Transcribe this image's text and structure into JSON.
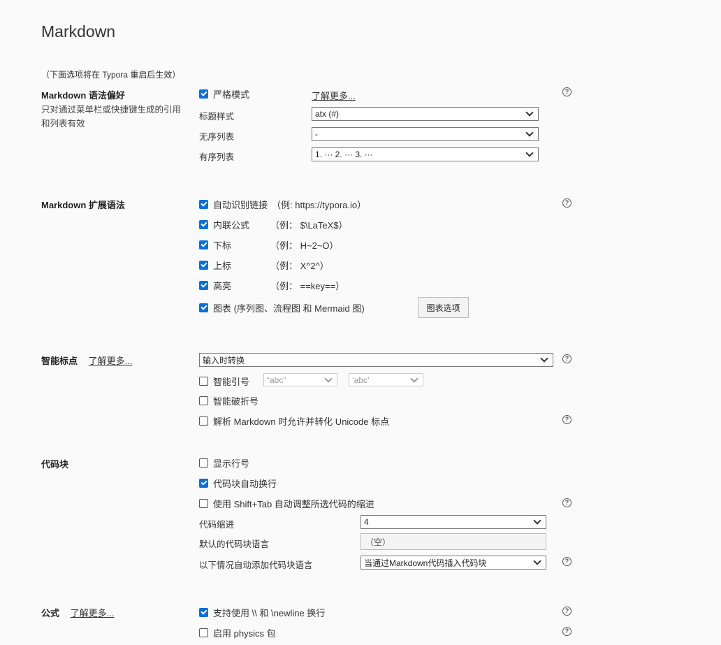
{
  "page_title": "Markdown",
  "restart_note": "（下面选项将在 Typora 重启后生效）",
  "syntax": {
    "title": "Markdown 语法偏好",
    "desc": "只对通过菜单栏或快捷键生成的引用和列表有效",
    "strict_mode_label": "严格模式",
    "strict_mode_checked": true,
    "learn_more": "了解更多...",
    "heading_style_label": "标题样式",
    "heading_style_value": "atx (#)",
    "unordered_label": "无序列表",
    "unordered_value": "-",
    "ordered_label": "有序列表",
    "ordered_value": "1. ··· 2. ··· 3. ···"
  },
  "extended": {
    "title": "Markdown 扩展语法",
    "items": [
      {
        "label": "自动识别链接",
        "example": "（例: https://typora.io）",
        "checked": true
      },
      {
        "label": "内联公式",
        "example": "（例：  $\\LaTeX$）",
        "checked": true
      },
      {
        "label": "下标",
        "example": "（例：  H~2~O）",
        "checked": true
      },
      {
        "label": "上标",
        "example": "（例：  X^2^）",
        "checked": true
      },
      {
        "label": "高亮",
        "example": "（例：  ==key==）",
        "checked": true
      },
      {
        "label": "图表 (序列图、流程图 和 Mermaid 图)",
        "example": "",
        "checked": true
      }
    ],
    "chart_options_button": "图表选项"
  },
  "smart_punct": {
    "title": "智能标点",
    "learn_more": "了解更多...",
    "mode_value": "输入时转换",
    "smart_quotes_label": "智能引号",
    "smart_quotes_checked": false,
    "double_quote_value": "“abc”",
    "single_quote_value": "‘abc’",
    "smart_dash_label": "智能破折号",
    "smart_dash_checked": false,
    "unicode_label": "解析 Markdown 时允许并转化 Unicode 标点",
    "unicode_checked": false
  },
  "code": {
    "title": "代码块",
    "line_numbers_label": "显示行号",
    "line_numbers_checked": false,
    "wrap_label": "代码块自动换行",
    "wrap_checked": true,
    "shift_tab_label": "使用 Shift+Tab 自动调整所选代码的缩进",
    "shift_tab_checked": false,
    "indent_label": "代码缩进",
    "indent_value": "4",
    "default_lang_label": "默认的代码块语言",
    "default_lang_placeholder": "（空）",
    "auto_lang_label": "以下情况自动添加代码块语言",
    "auto_lang_value": "当通过Markdown代码插入代码块"
  },
  "math": {
    "title": "公式",
    "learn_more": "了解更多...",
    "newline_label": "支持使用 \\\\ 和 \\newline 换行",
    "newline_checked": true,
    "physics_label": "启用 physics 包",
    "physics_checked": false
  },
  "icons": {
    "help": "help-circle-icon",
    "chevron": "chevron-down-icon",
    "check": "check-icon"
  },
  "colors": {
    "accent": "#0a6fd8",
    "background": "#fafafa"
  }
}
